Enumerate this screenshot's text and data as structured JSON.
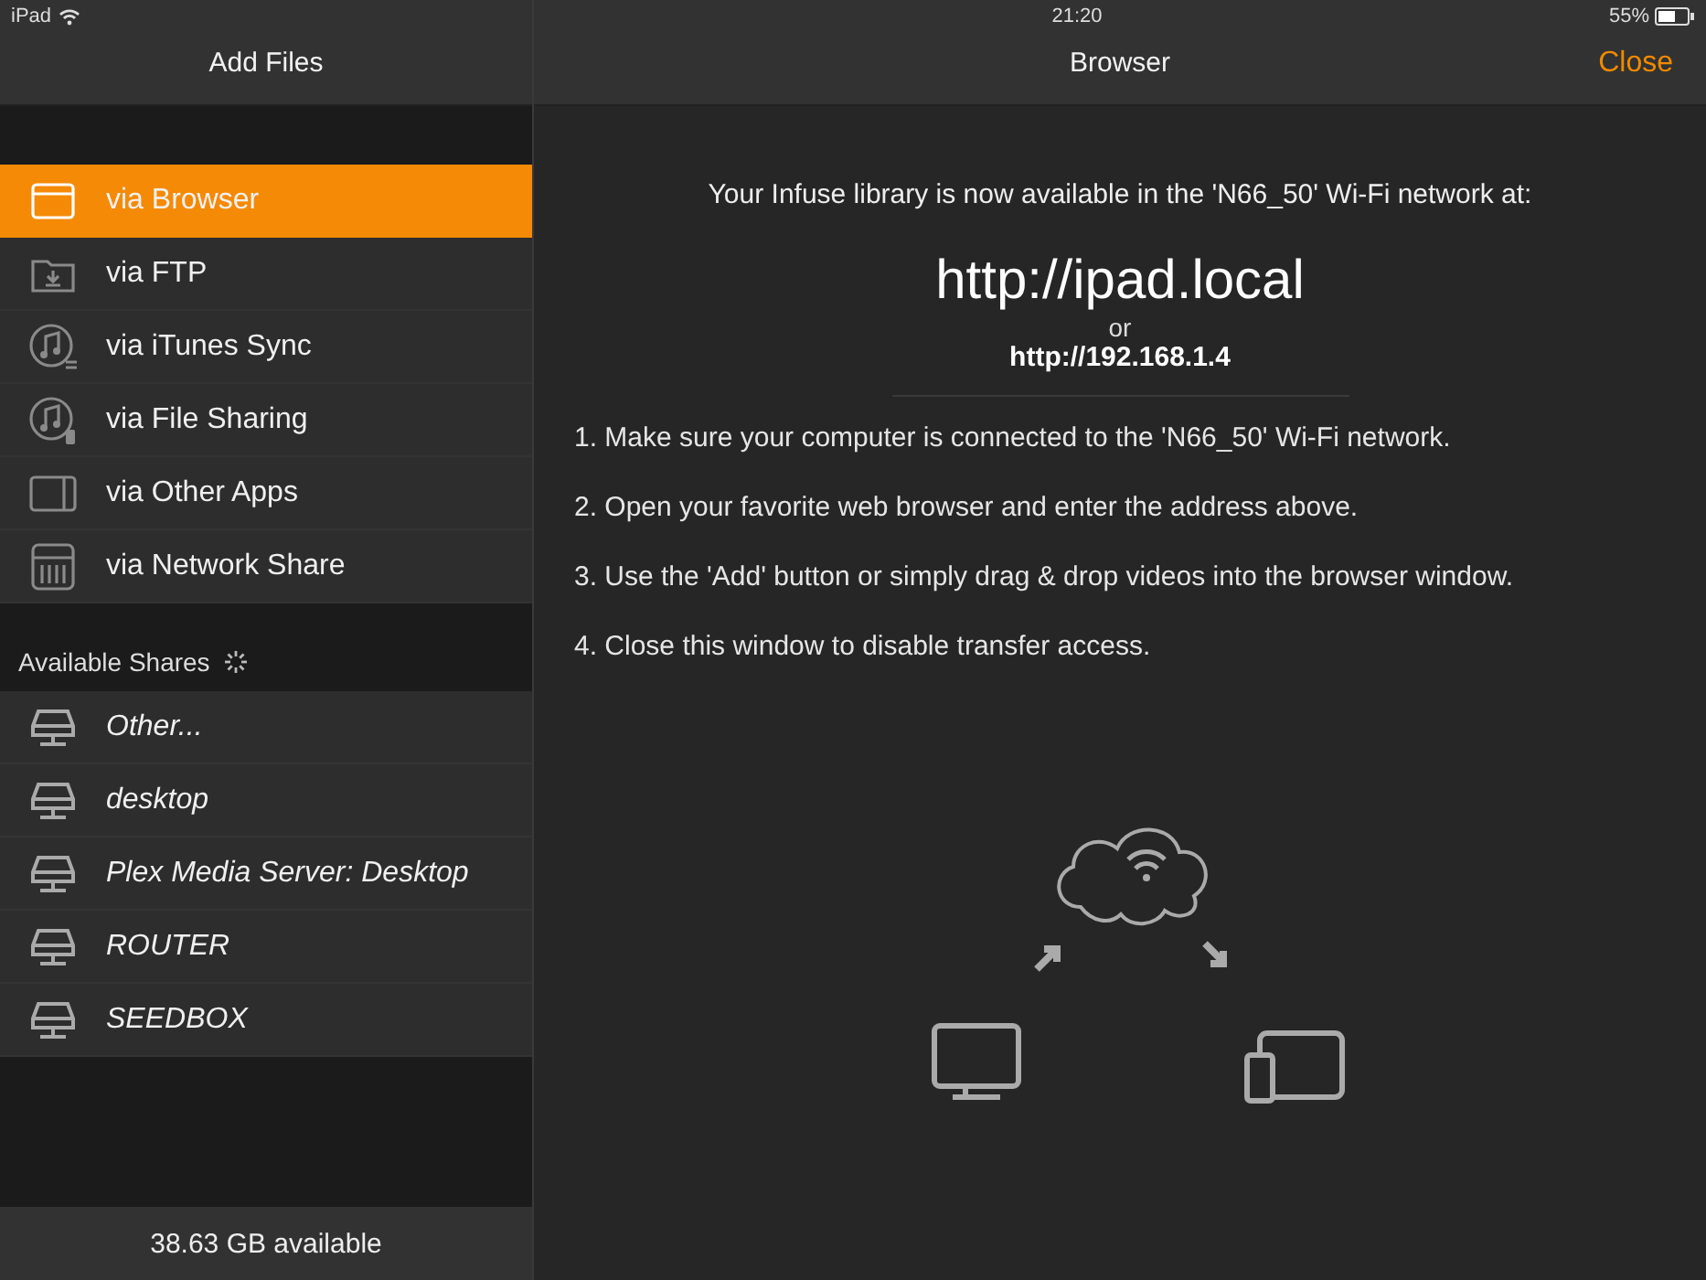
{
  "status_bar": {
    "device": "iPad",
    "time": "21:20",
    "battery": "55%"
  },
  "left_panel": {
    "title": "Add Files",
    "methods": [
      {
        "label": "via Browser",
        "kind": "browser",
        "selected": true
      },
      {
        "label": "via FTP",
        "kind": "ftp",
        "selected": false
      },
      {
        "label": "via iTunes Sync",
        "kind": "itunes",
        "selected": false
      },
      {
        "label": "via File Sharing",
        "kind": "filesharing",
        "selected": false
      },
      {
        "label": "via Other Apps",
        "kind": "apps",
        "selected": false
      },
      {
        "label": "via Network Share",
        "kind": "network",
        "selected": false
      }
    ],
    "shares_header": "Available Shares",
    "shares": [
      "Other...",
      "desktop",
      "Plex Media Server: Desktop",
      "ROUTER",
      "SEEDBOX"
    ],
    "footer": "38.63 GB available"
  },
  "right_panel": {
    "title": "Browser",
    "close": "Close",
    "intro": "Your Infuse library is now available in the 'N66_50' Wi-Fi network at:",
    "url": "http://ipad.local",
    "or": "or",
    "ip": "http://192.168.1.4",
    "steps": [
      "1. Make sure your computer is connected to the 'N66_50' Wi-Fi network.",
      "2. Open your favorite web browser and enter the address above.",
      "3. Use the 'Add' button or simply drag & drop videos into the browser window.",
      "4. Close this window to disable transfer access."
    ]
  }
}
